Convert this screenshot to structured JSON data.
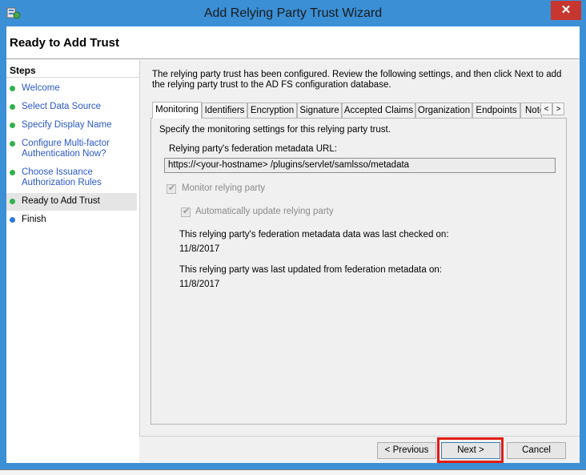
{
  "window": {
    "title": "Add Relying Party Trust Wizard",
    "close_glyph": "✕"
  },
  "header": {
    "page_title": "Ready to Add Trust"
  },
  "steps": {
    "heading": "Steps",
    "items": [
      {
        "label": "Welcome",
        "status": "complete"
      },
      {
        "label": "Select Data Source",
        "status": "complete"
      },
      {
        "label": "Specify Display Name",
        "status": "complete"
      },
      {
        "label": "Configure Multi-factor Authentication Now?",
        "status": "complete"
      },
      {
        "label": "Choose Issuance Authorization Rules",
        "status": "complete"
      },
      {
        "label": "Ready to Add Trust",
        "status": "current"
      },
      {
        "label": "Finish",
        "status": "pending"
      }
    ]
  },
  "main": {
    "intro": "The relying party trust has been configured. Review the following settings, and then click Next to add the relying party trust to the AD FS configuration database.",
    "tabs": [
      "Monitoring",
      "Identifiers",
      "Encryption",
      "Signature",
      "Accepted Claims",
      "Organization",
      "Endpoints",
      "Note"
    ],
    "active_tab": "Monitoring",
    "tab_scroll_left": "<",
    "tab_scroll_right": ">",
    "monitoring": {
      "description": "Specify the monitoring settings for this relying party trust.",
      "url_label": "Relying party's federation metadata URL:",
      "url_value": "https://<your-hostname> /plugins/servlet/samlsso/metadata",
      "monitor_label": "Monitor relying party",
      "monitor_checked": true,
      "auto_update_label": "Automatically update relying party",
      "auto_update_checked": true,
      "last_checked_label": "This relying party's federation metadata data was last checked on:",
      "last_checked_value": "11/8/2017",
      "last_updated_label": "This relying party was last updated from federation metadata on:",
      "last_updated_value": "11/8/2017"
    }
  },
  "buttons": {
    "previous": "< Previous",
    "next": "Next >",
    "cancel": "Cancel"
  },
  "colors": {
    "titlebar": "#3b8fd5",
    "close": "#c7372f",
    "highlight": "#e21c14",
    "step_complete": "#2fb24b",
    "step_pending": "#2a7bd5",
    "link": "#2a59c9"
  }
}
